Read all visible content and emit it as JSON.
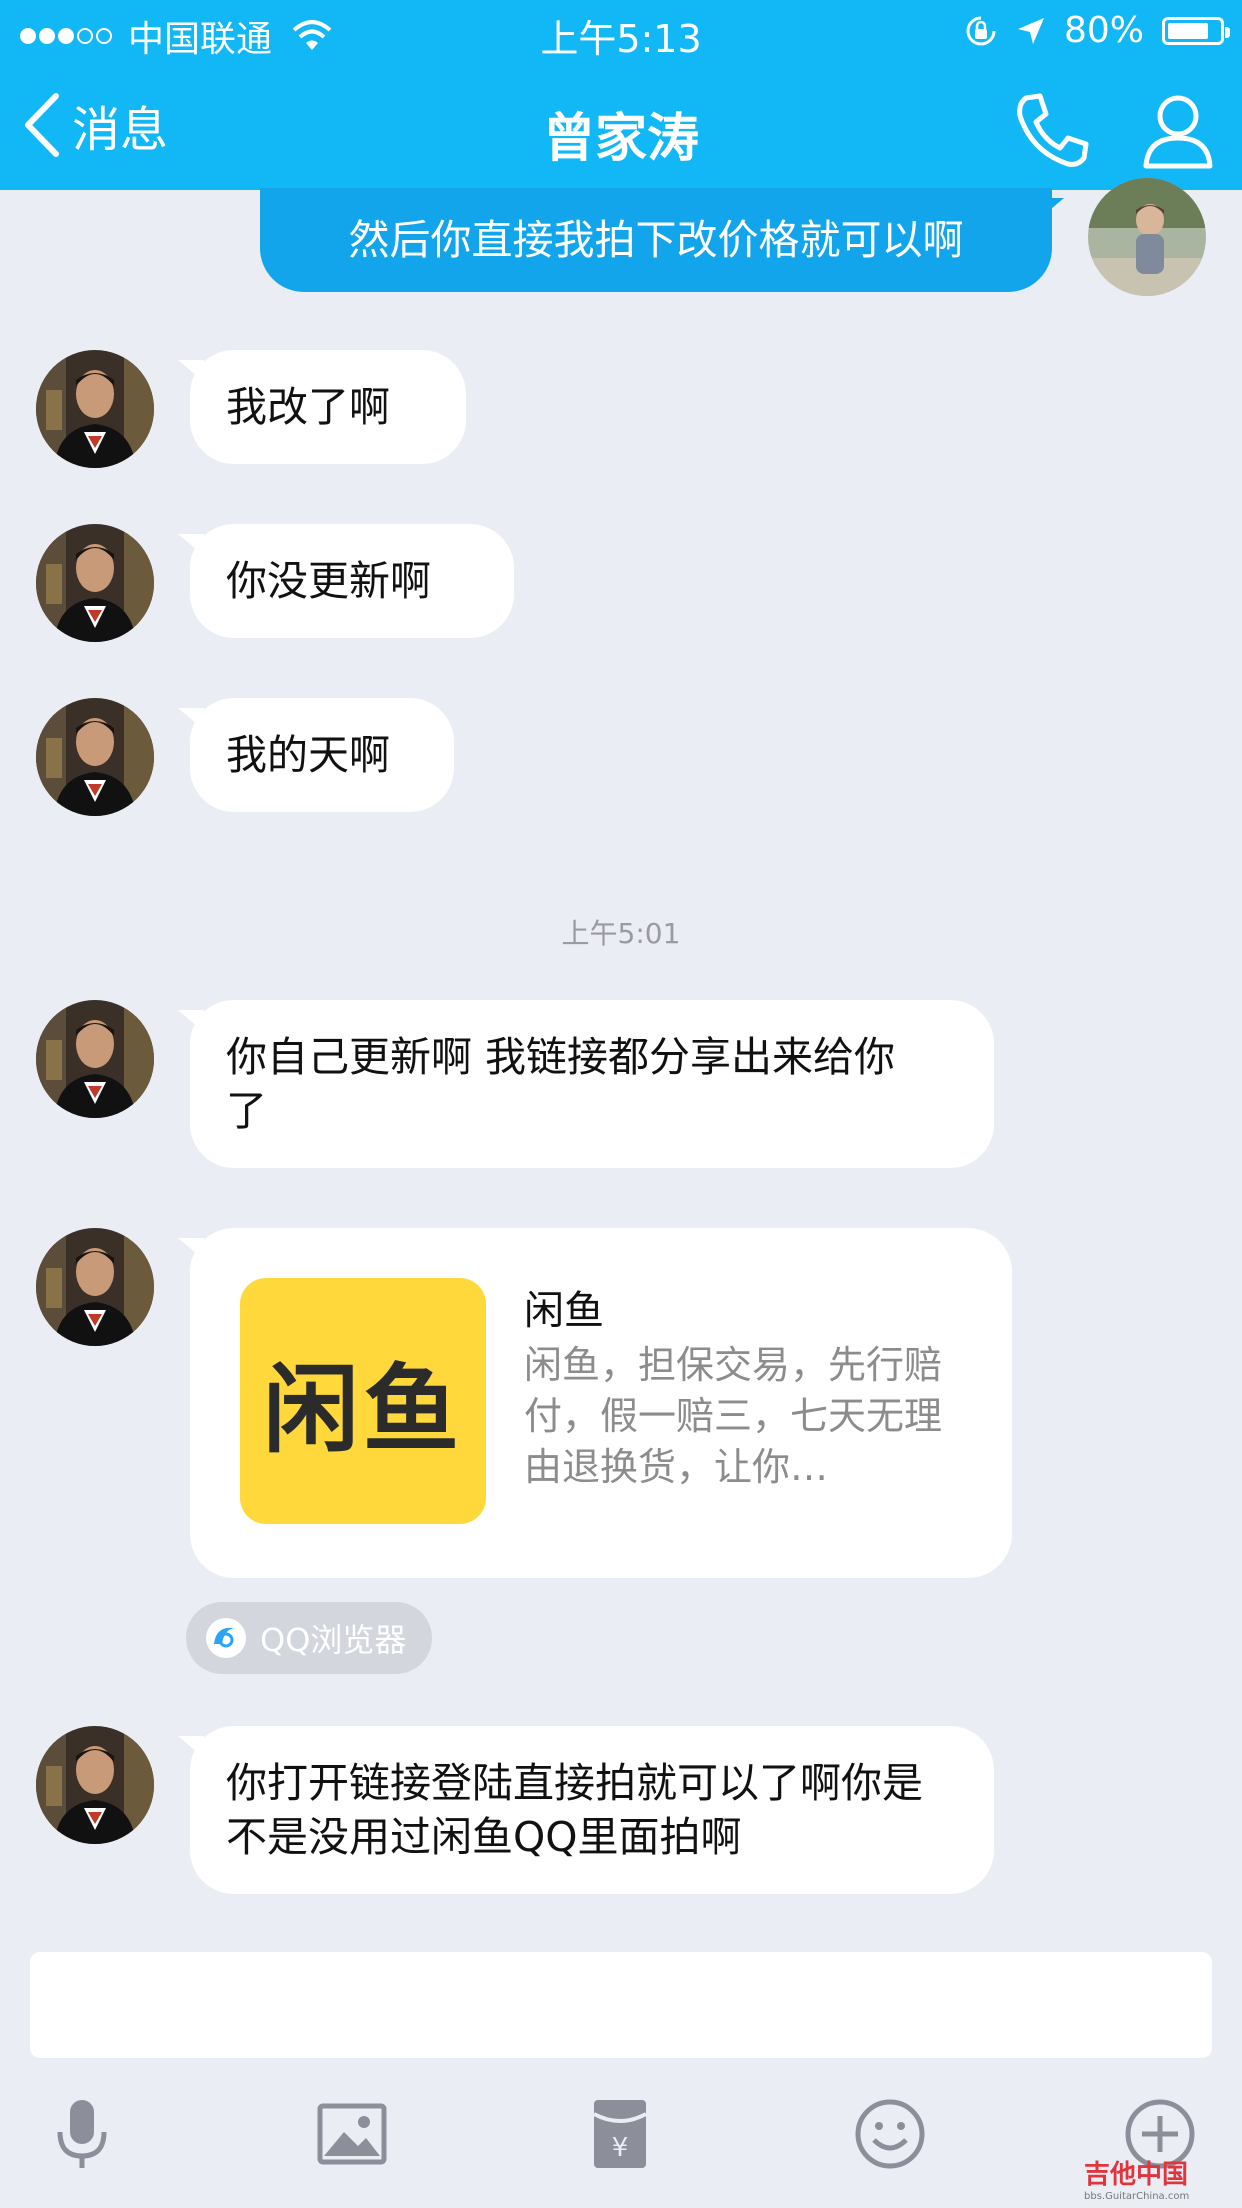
{
  "status_bar": {
    "carrier": "中国联通",
    "time": "上午5:13",
    "battery": "80%",
    "battery_level": 0.8
  },
  "nav": {
    "back_label": "消息",
    "title": "曾家涛"
  },
  "messages": [
    {
      "direction": "out",
      "text": "然后你直接我拍下改价格就可以啊"
    },
    {
      "direction": "in",
      "text": "我改了啊"
    },
    {
      "direction": "in",
      "text": "你没更新啊"
    },
    {
      "direction": "in",
      "text": "我的天啊"
    },
    {
      "direction": "in",
      "text": "你自己更新啊 我链接都分享出来给你了"
    },
    {
      "direction": "in",
      "text": "你打开链接登陆直接拍就可以了啊你是不是没用过闲鱼QQ里面拍啊"
    }
  ],
  "timestamp": "上午5:01",
  "share_card": {
    "logo_text": "闲鱼",
    "title": "闲鱼",
    "description": "闲鱼，担保交易，先行赔付，假一赔三，七天无理由退换货，让你…",
    "source": "QQ浏览器"
  },
  "input": {
    "value": ""
  },
  "watermark": {
    "text": "吉他中国",
    "sub": "bbs.GuitarChina.com"
  },
  "colors": {
    "accent": "#12b7f5",
    "outgoing_bubble": "#12a5ec",
    "background": "#ebedf5",
    "logo_yellow": "#ffd93b"
  },
  "icons": [
    "back-chevron-icon",
    "phone-icon",
    "profile-icon",
    "microphone-icon",
    "image-icon",
    "red-packet-icon",
    "emoji-icon",
    "plus-icon"
  ]
}
